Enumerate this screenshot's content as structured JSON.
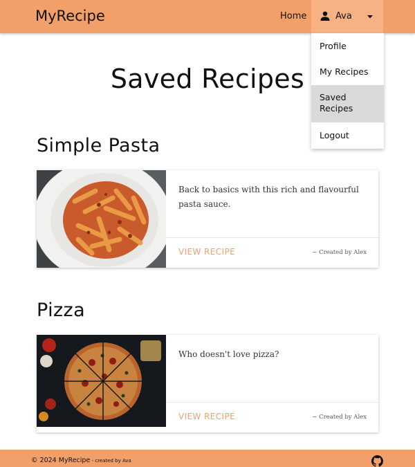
{
  "navbar": {
    "brand": "MyRecipe",
    "home_label": "Home",
    "user_name": "Ava",
    "icons": {
      "user": "person-icon",
      "caret": "caret-down-icon"
    },
    "dropdown": [
      {
        "label": "Profile",
        "active": false
      },
      {
        "label": "My Recipes",
        "active": false
      },
      {
        "label": "Saved Recipes",
        "active": true
      },
      {
        "label": "Logout",
        "active": false
      }
    ]
  },
  "page": {
    "title": "Saved Recipes"
  },
  "recipes": [
    {
      "title": "Simple Pasta",
      "description": "Back to basics with this rich and flavourful pasta sauce.",
      "link_label": "VIEW RECIPE",
      "author": "~ Created by Alex",
      "image": "pasta-photo"
    },
    {
      "title": "Pizza",
      "description": "Who doesn't love pizza?",
      "link_label": "VIEW RECIPE",
      "author": "~ Created by Alex",
      "image": "pizza-photo"
    }
  ],
  "footer": {
    "copyright": "© 2024 MyRecipe",
    "created_by": " - created by Ava",
    "icon": "github-icon"
  },
  "colors": {
    "primary": "#f2a06a",
    "primary_light": "#f7b283",
    "active_item": "#d9d9d9"
  }
}
